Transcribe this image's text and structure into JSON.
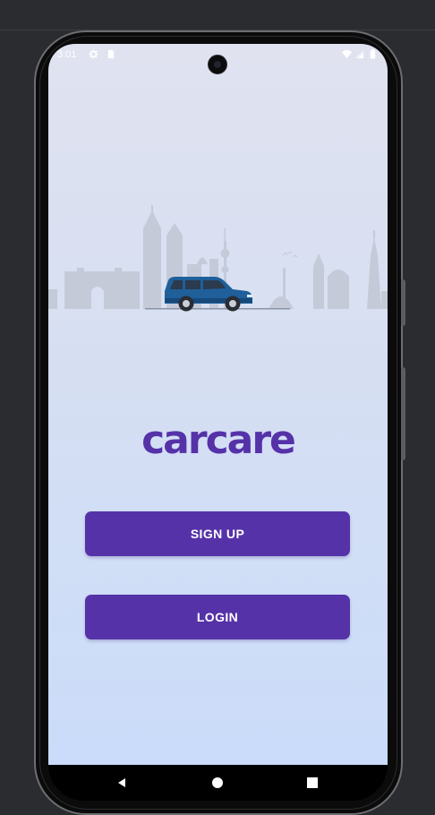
{
  "status_bar": {
    "time": "3:01",
    "icons": [
      "settings-icon",
      "sim-card-icon",
      "wifi-icon",
      "signal-icon",
      "battery-icon"
    ]
  },
  "hero": {
    "illustration": "city-skyline-with-blue-suv"
  },
  "brand": {
    "logo_text": "carcare",
    "color": "#5532a8"
  },
  "actions": {
    "signup_label": "SIGN UP",
    "login_label": "LOGIN",
    "button_color": "#5532a8"
  },
  "nav_bar": {
    "buttons": [
      "back-icon",
      "home-icon",
      "recents-icon"
    ]
  }
}
